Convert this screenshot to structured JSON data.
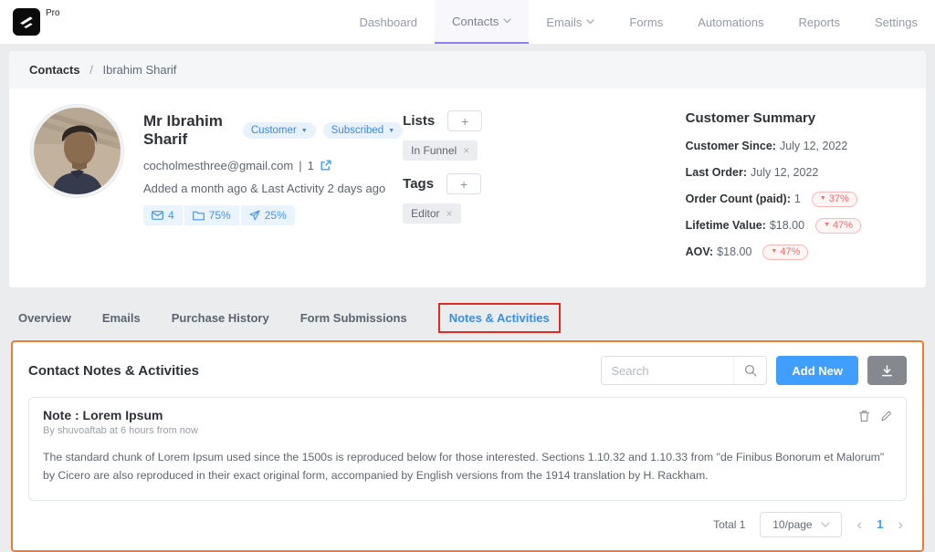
{
  "colors": {
    "accent_blue": "#409eff",
    "light_blue_badge_bg": "#e8f2fd",
    "nav_active_underline": "#8b80ec",
    "annotation_red": "#e02b20",
    "annotation_orange": "#ed7d31",
    "trend_red": "#f56c6c",
    "export_button_gray": "#85898f"
  },
  "icons": {
    "plus": "+",
    "close": "×",
    "caret_down": "▼",
    "breadcrumb_separator": "/",
    "pipe": "|",
    "prev": "‹",
    "next": "›"
  },
  "topbar": {
    "pro_label": "Pro",
    "nav": [
      {
        "label": "Dashboard",
        "dropdown": false,
        "active": false
      },
      {
        "label": "Contacts",
        "dropdown": true,
        "active": true
      },
      {
        "label": "Emails",
        "dropdown": true,
        "active": false
      },
      {
        "label": "Forms",
        "dropdown": false,
        "active": false
      },
      {
        "label": "Automations",
        "dropdown": false,
        "active": false
      },
      {
        "label": "Reports",
        "dropdown": false,
        "active": false
      },
      {
        "label": "Settings",
        "dropdown": false,
        "active": false
      }
    ]
  },
  "breadcrumb": {
    "section": "Contacts",
    "current": "Ibrahim Sharif"
  },
  "contact": {
    "name": "Mr Ibrahim Sharif",
    "badges": [
      {
        "label": "Customer"
      },
      {
        "label": "Subscribed"
      }
    ],
    "email": "cocholmesthree@gmail.com",
    "email_count": "1",
    "activity": "Added a month ago & Last Activity 2 days ago",
    "stats": [
      {
        "icon": "envelope-icon",
        "value": "4"
      },
      {
        "icon": "folder-icon",
        "value": "75%"
      },
      {
        "icon": "send-icon",
        "value": "25%"
      }
    ]
  },
  "lists": {
    "title": "Lists",
    "items": [
      {
        "label": "In Funnel"
      }
    ]
  },
  "tags": {
    "title": "Tags",
    "items": [
      {
        "label": "Editor"
      }
    ]
  },
  "summary": {
    "title": "Customer Summary",
    "rows": [
      {
        "label": "Customer Since:",
        "value": "July 12, 2022"
      },
      {
        "label": "Last Order:",
        "value": "July 12, 2022"
      },
      {
        "label": "Order Count (paid):",
        "value": "1",
        "trend": "37%"
      },
      {
        "label": "Lifetime Value:",
        "value": "$18.00",
        "trend": "47%"
      },
      {
        "label": "AOV:",
        "value": "$18.00",
        "trend": "47%"
      }
    ]
  },
  "tabs": [
    {
      "label": "Overview",
      "active": false
    },
    {
      "label": "Emails",
      "active": false
    },
    {
      "label": "Purchase History",
      "active": false
    },
    {
      "label": "Form Submissions",
      "active": false
    },
    {
      "label": "Notes & Activities",
      "active": true
    }
  ],
  "notes_panel": {
    "title": "Contact Notes & Activities",
    "search_placeholder": "Search",
    "add_button": "Add New",
    "note": {
      "title": "Note : Lorem Ipsum",
      "byline": "By shuvoaftab at 6 hours from now",
      "body": "The standard chunk of Lorem Ipsum used since the 1500s is reproduced below for those interested. Sections 1.10.32 and 1.10.33 from \"de Finibus Bonorum et Malorum\" by Cicero are also reproduced in their exact original form, accompanied by English versions from the 1914 translation by H. Rackham."
    },
    "pagination": {
      "total": "Total 1",
      "page_size": "10/page",
      "page": "1"
    }
  }
}
